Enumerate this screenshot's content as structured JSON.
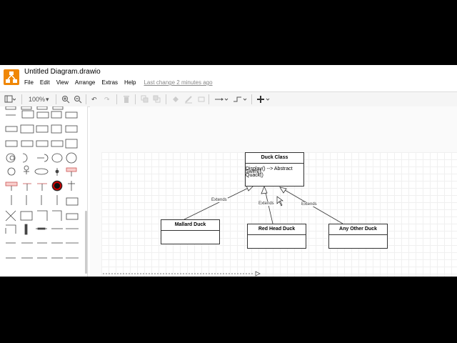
{
  "app": {
    "title": "Untitled Diagram.drawio",
    "menu": [
      "File",
      "Edit",
      "View",
      "Arrange",
      "Extras",
      "Help"
    ],
    "last_change": "Last change 2 minutes ago"
  },
  "toolbar": {
    "zoom": "100%"
  },
  "diagram": {
    "classes": [
      {
        "name": "Duck Class",
        "ops": [
          "Display() --> Abstract",
          "Swim()",
          "Quack()"
        ]
      },
      {
        "name": "Mallard Duck"
      },
      {
        "name": "Red Head Duck"
      },
      {
        "name": "Any Other Duck"
      }
    ],
    "edge_labels": [
      "Extends",
      "Extends",
      "Extends"
    ]
  }
}
